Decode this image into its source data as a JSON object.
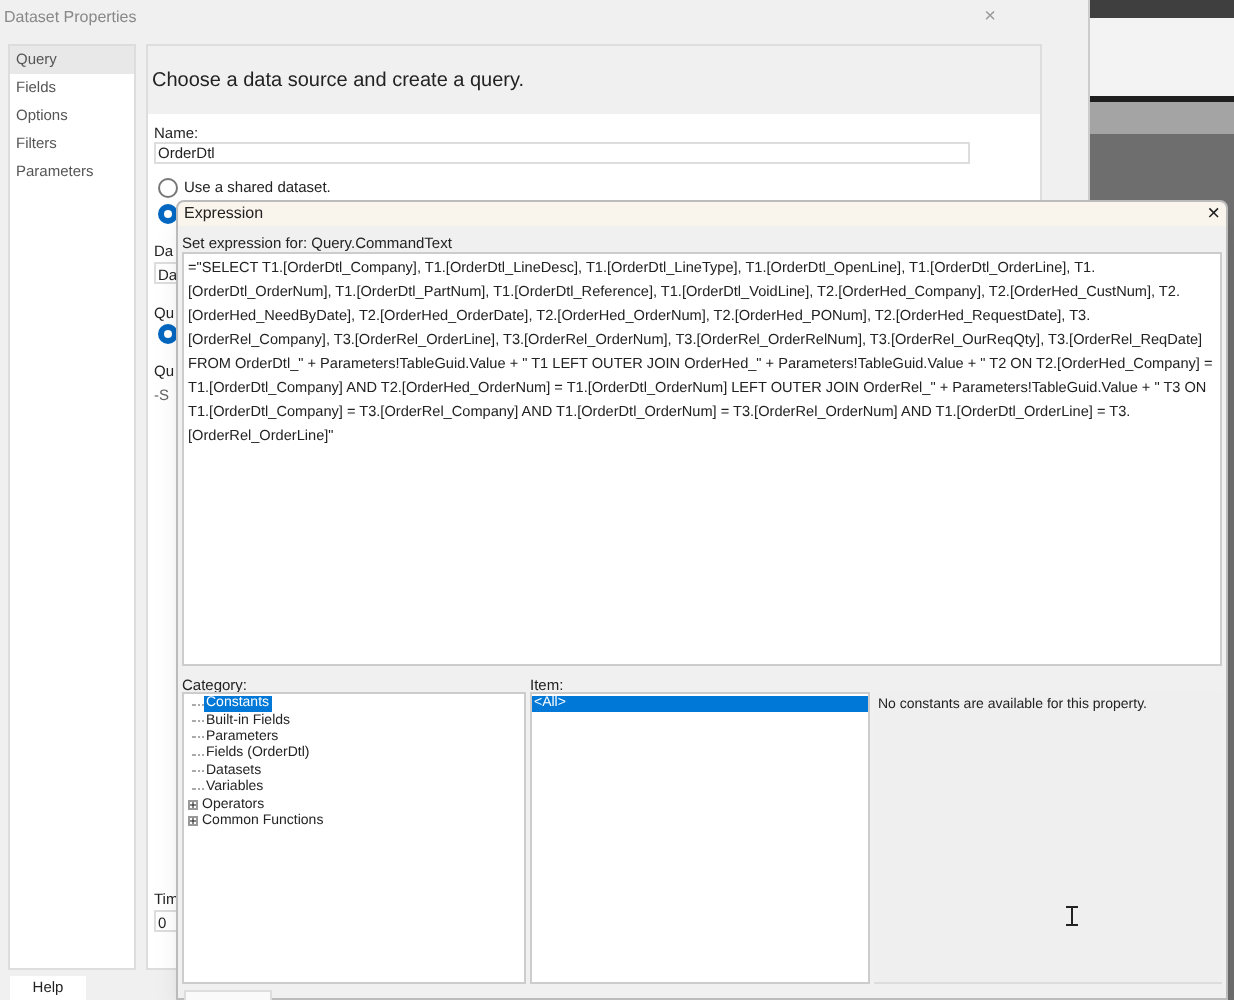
{
  "dataset_window": {
    "title": "Dataset Properties",
    "close": "×",
    "nav": [
      {
        "label": "Query",
        "selected": true
      },
      {
        "label": "Fields",
        "selected": false
      },
      {
        "label": "Options",
        "selected": false
      },
      {
        "label": "Filters",
        "selected": false
      },
      {
        "label": "Parameters",
        "selected": false
      }
    ],
    "heading": "Choose a data source and create a query.",
    "name_label": "Name:",
    "name_value": "OrderDtl",
    "radios": [
      {
        "label": "Use a shared dataset.",
        "selected": false
      },
      {
        "selected": true
      }
    ],
    "partial_labels": [
      "Da",
      "Da",
      "Qu"
    ],
    "partial_radio": {
      "selected": true
    },
    "partial_labels_2": [
      "Qu",
      "-S"
    ],
    "time_label": "Tim",
    "time_value": "0",
    "help_button": "Help"
  },
  "expression_window": {
    "title": "Expression",
    "close": "×",
    "set_label": "Set expression for: Query.CommandText",
    "expression": "=\"SELECT  T1.[OrderDtl_Company], T1.[OrderDtl_LineDesc], T1.[OrderDtl_LineType], T1.[OrderDtl_OpenLine], T1.[OrderDtl_OrderLine], T1.[OrderDtl_OrderNum], T1.[OrderDtl_PartNum], T1.[OrderDtl_Reference], T1.[OrderDtl_VoidLine], T2.[OrderHed_Company], T2.[OrderHed_CustNum], T2.[OrderHed_NeedByDate], T2.[OrderHed_OrderDate], T2.[OrderHed_OrderNum], T2.[OrderHed_PONum], T2.[OrderHed_RequestDate], T3.[OrderRel_Company], T3.[OrderRel_OrderLine], T3.[OrderRel_OrderNum], T3.[OrderRel_OrderRelNum], T3.[OrderRel_OurReqQty], T3.[OrderRel_ReqDate] FROM OrderDtl_\" + Parameters!TableGuid.Value + \" T1 LEFT OUTER JOIN OrderHed_\" + Parameters!TableGuid.Value + \" T2 ON  T2.[OrderHed_Company] = T1.[OrderDtl_Company] AND T2.[OrderHed_OrderNum] = T1.[OrderDtl_OrderNum] LEFT OUTER JOIN OrderRel_\" + Parameters!TableGuid.Value + \" T3 ON  T1.[OrderDtl_Company] = T3.[OrderRel_Company] AND T1.[OrderDtl_OrderNum] = T3.[OrderRel_OrderNum] AND T1.[OrderDtl_OrderLine] = T3.[OrderRel_OrderLine]\"",
    "category_label": "Category:",
    "categories": [
      {
        "label": "Constants",
        "kind": "leaf",
        "selected": true
      },
      {
        "label": "Built-in Fields",
        "kind": "leaf",
        "selected": false
      },
      {
        "label": "Parameters",
        "kind": "leaf",
        "selected": false
      },
      {
        "label": "Fields (OrderDtl)",
        "kind": "leaf",
        "selected": false
      },
      {
        "label": "Datasets",
        "kind": "leaf",
        "selected": false
      },
      {
        "label": "Variables",
        "kind": "leaf",
        "selected": false
      },
      {
        "label": "Operators",
        "kind": "group",
        "expanded": false,
        "selected": false
      },
      {
        "label": "Common Functions",
        "kind": "group",
        "expanded": false,
        "selected": false
      }
    ],
    "item_label": "Item:",
    "items": [
      {
        "label": "<All>",
        "selected": true
      }
    ],
    "description": "No constants are available for this property."
  }
}
